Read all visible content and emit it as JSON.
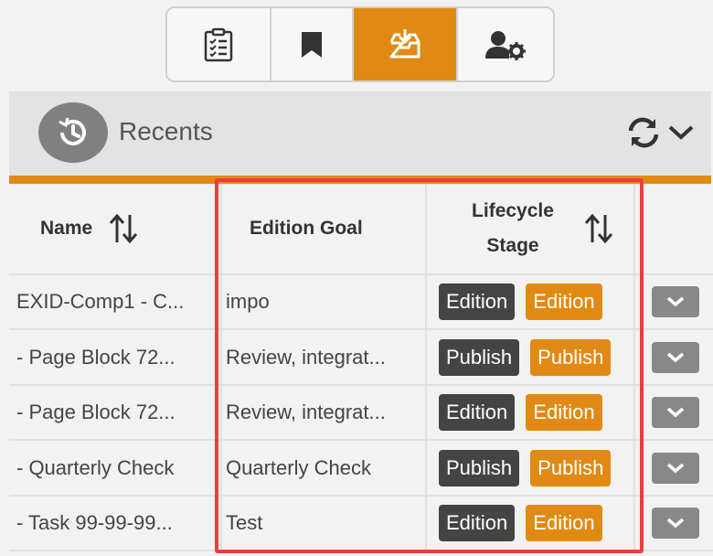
{
  "toolbar": {
    "buttons": [
      {
        "icon": "clipboard-checklist-icon"
      },
      {
        "icon": "bookmark-icon"
      },
      {
        "icon": "inbox-download-icon",
        "active": true
      },
      {
        "icon": "user-settings-icon"
      }
    ]
  },
  "recents": {
    "title": "Recents",
    "icon": "history-icon"
  },
  "table": {
    "headers": {
      "name": "Name",
      "edition_goal": "Edition Goal",
      "lifecycle_line1": "Lifecycle",
      "lifecycle_line2": "Stage"
    },
    "rows": [
      {
        "name": "EXID-Comp1 - C...",
        "goal": "impo",
        "stage": "Edition",
        "stage2": "Edition"
      },
      {
        "name": "- Page Block 72...",
        "goal": "Review, integrat...",
        "stage": "Publish",
        "stage2": "Publish"
      },
      {
        "name": "- Page Block 72...",
        "goal": "Review, integrat...",
        "stage": "Edition",
        "stage2": "Edition"
      },
      {
        "name": "- Quarterly Check",
        "goal": "Quarterly Check",
        "stage": "Publish",
        "stage2": "Publish"
      },
      {
        "name": "- Task 99-99-99...",
        "goal": "Test",
        "stage": "Edition",
        "stage2": "Edition"
      }
    ]
  },
  "colors": {
    "accent": "#e08a14",
    "badge_dark": "#444444",
    "highlight": "#ee3d3d"
  }
}
